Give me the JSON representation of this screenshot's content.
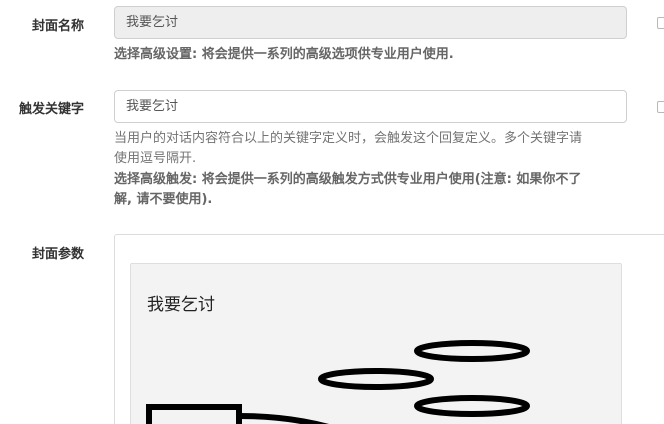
{
  "form": {
    "cover_name": {
      "label": "封面名称",
      "value": "我要乞讨",
      "help_bold": "选择高级设置: 将会提供一系列的高级选项供专业用户使用."
    },
    "trigger_keyword": {
      "label": "触发关键字",
      "value": "我要乞讨",
      "help_line1": "当用户的对话内容符合以上的关键字定义时，会触发这个回复定义。多个关键字请",
      "help_line2": "使用逗号隔开.",
      "help_bold_line1": "选择高级触发: 将会提供一系列的高级触发方式供专业用户使用(注意: 如果你不了",
      "help_bold_line2": "解, 请不要使用)."
    },
    "cover_params": {
      "label": "封面参数",
      "card_title": "我要乞讨"
    }
  }
}
